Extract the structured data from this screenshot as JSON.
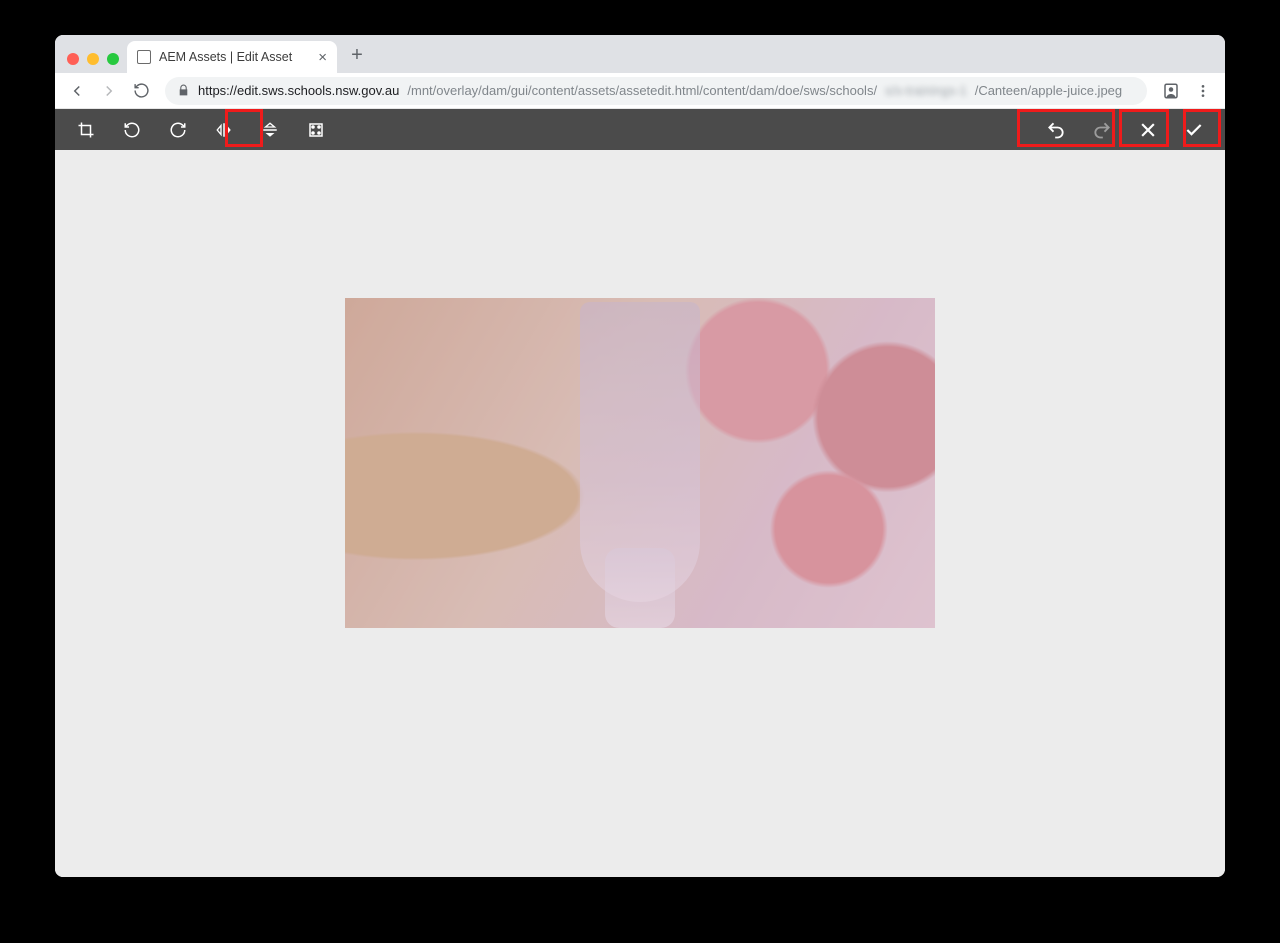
{
  "browser": {
    "tab_title": "AEM Assets | Edit Asset",
    "url_host": "https://edit.sws.schools.nsw.gov.au",
    "url_path1": "/mnt/overlay/dam/gui/content/assets/assetedit.html/content/dam/doe/sws/schools/",
    "url_blur": "s/s-trainings-1",
    "url_path2": "/Canteen/apple-juice.jpeg"
  },
  "toolbar": {
    "crop": "crop-icon",
    "rotate_left": "rotate-left-icon",
    "rotate_right": "rotate-right-icon",
    "flip_vertical": "flip-vertical-icon",
    "flip_horizontal": "flip-horizontal-icon",
    "launch_map": "launch-map-icon",
    "undo": "undo-icon",
    "redo": "redo-icon",
    "cancel": "cancel-icon",
    "confirm": "confirm-icon"
  },
  "highlights": {
    "flip_vertical": true,
    "undo_redo": true,
    "cancel": true,
    "confirm": true
  },
  "image": {
    "alt": "apple juice photo, flipped upside down"
  }
}
